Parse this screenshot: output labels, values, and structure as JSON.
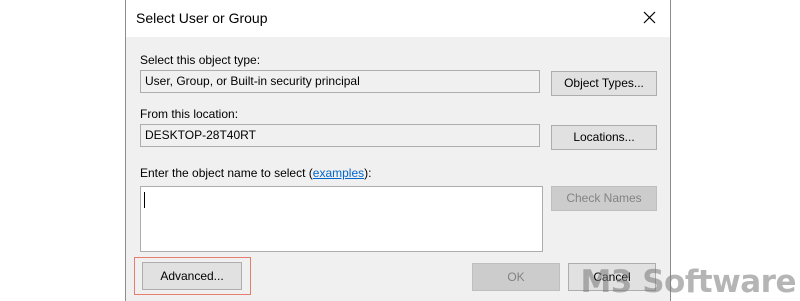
{
  "dialog": {
    "title": "Select User or Group",
    "object_type": {
      "label": "Select this object type:",
      "value": "User, Group, or Built-in security principal",
      "button": "Object Types..."
    },
    "location": {
      "label": "From this location:",
      "value": "DESKTOP-28T40RT",
      "button": "Locations..."
    },
    "object_name": {
      "label_prefix": "Enter the object name to select (",
      "label_link": "examples",
      "label_suffix": "):",
      "value": "",
      "check_names_button": "Check Names"
    },
    "advanced_button": "Advanced...",
    "ok_button": "OK",
    "cancel_button": "Cancel"
  },
  "watermark": {
    "text": "M3 Software"
  },
  "colors": {
    "dialog_bg": "#f0f0f0",
    "link": "#0066cc",
    "highlight": "#e67e6e"
  }
}
